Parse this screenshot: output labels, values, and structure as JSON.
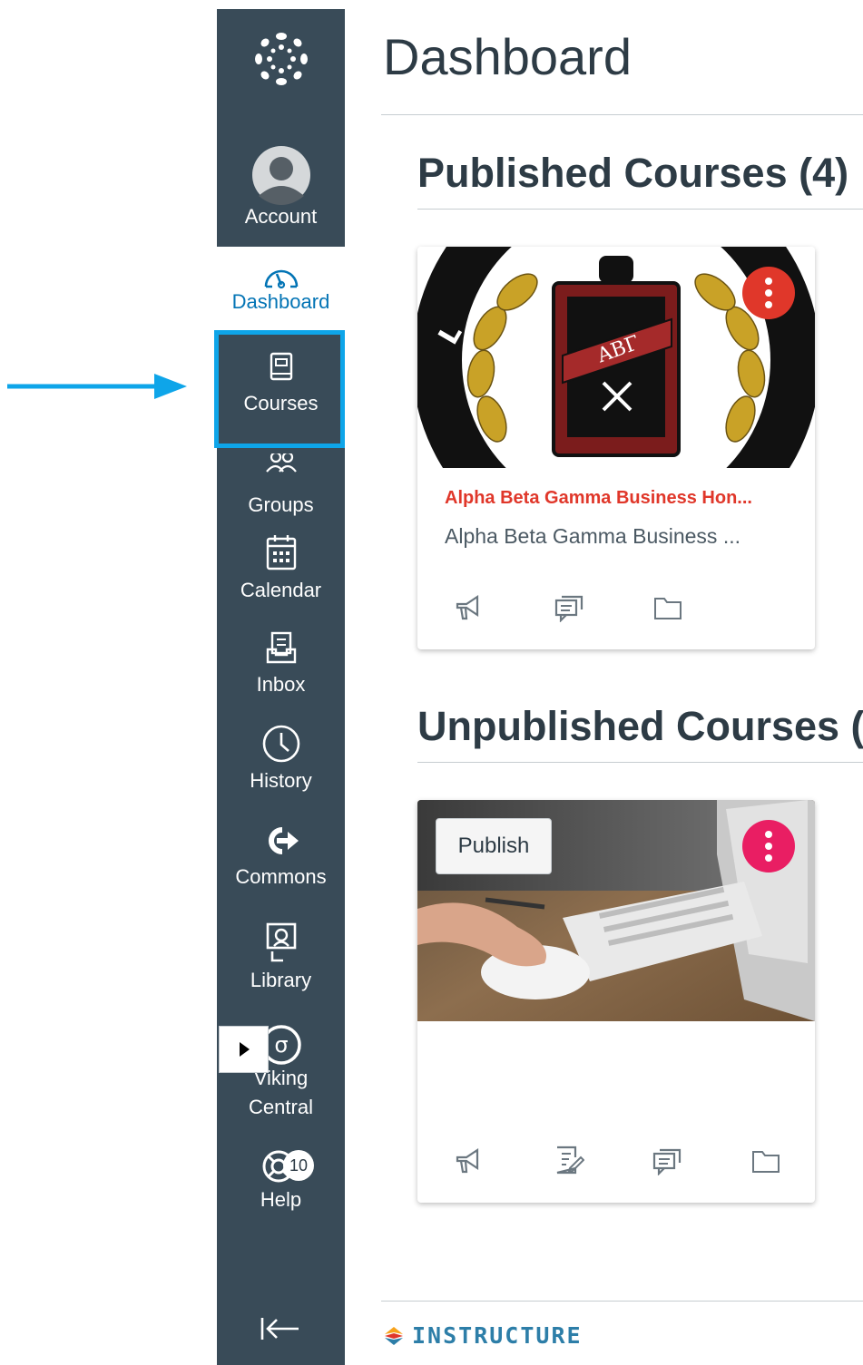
{
  "page": {
    "title": "Dashboard"
  },
  "nav": {
    "account_label": "Account",
    "items": [
      {
        "id": "dashboard",
        "label": "Dashboard",
        "icon": "dashboard-icon",
        "active": true
      },
      {
        "id": "courses",
        "label": "Courses",
        "icon": "book-icon"
      },
      {
        "id": "groups",
        "label": "Groups",
        "icon": "groups-icon"
      },
      {
        "id": "calendar",
        "label": "Calendar",
        "icon": "calendar-icon"
      },
      {
        "id": "inbox",
        "label": "Inbox",
        "icon": "inbox-icon"
      },
      {
        "id": "history",
        "label": "History",
        "icon": "clock-icon"
      },
      {
        "id": "commons",
        "label": "Commons",
        "icon": "commons-icon"
      },
      {
        "id": "library",
        "label": "Library",
        "icon": "library-icon"
      },
      {
        "id": "viking",
        "label_line1": "Viking",
        "label_line2": "Central",
        "icon": "sigma-icon"
      },
      {
        "id": "help",
        "label": "Help",
        "icon": "help-icon",
        "badge": "10"
      }
    ]
  },
  "sections": {
    "published": {
      "title": "Published Courses (4)"
    },
    "unpublished": {
      "title": "Unpublished Courses (1"
    }
  },
  "published_card": {
    "name": "Alpha Beta Gamma Business Hon...",
    "subtitle": "Alpha Beta Gamma Business ...",
    "emblem_letters": "ΑΒΓ",
    "kebab_color": "#e0372a",
    "icons": [
      "announcements-icon",
      "discussions-icon",
      "files-icon"
    ]
  },
  "unpublished_card": {
    "publish_label": "Publish",
    "kebab_color": "#e91e63",
    "icons": [
      "announcements-icon",
      "assignments-icon",
      "discussions-icon",
      "files-icon"
    ]
  },
  "footer": {
    "brand": "INSTRUCTURE"
  },
  "colors": {
    "nav_bg": "#394b58",
    "link_blue": "#0374b5",
    "highlight": "#0ea5e9",
    "course_name_red": "#e0372a"
  }
}
